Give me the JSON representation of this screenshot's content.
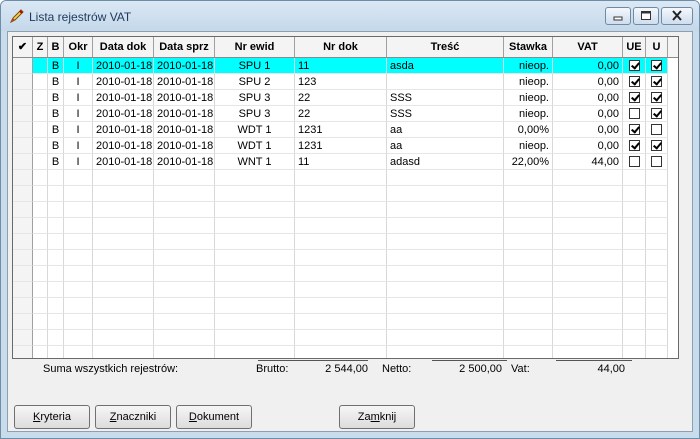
{
  "window": {
    "title": "Lista rejestrów VAT"
  },
  "grid": {
    "columns": [
      {
        "key": "mark",
        "label": "✔"
      },
      {
        "key": "z",
        "label": "Z"
      },
      {
        "key": "b",
        "label": "B"
      },
      {
        "key": "okr",
        "label": "Okr"
      },
      {
        "key": "data_dok",
        "label": "Data dok"
      },
      {
        "key": "data_sprz",
        "label": "Data sprz"
      },
      {
        "key": "nr_ewid",
        "label": "Nr ewid"
      },
      {
        "key": "nr_dok",
        "label": "Nr dok"
      },
      {
        "key": "tresc",
        "label": "Treść"
      },
      {
        "key": "stawka",
        "label": "Stawka"
      },
      {
        "key": "vat",
        "label": "VAT"
      },
      {
        "key": "ue",
        "label": "UE"
      },
      {
        "key": "u",
        "label": "U"
      }
    ],
    "rows": [
      {
        "z": "",
        "b": "B",
        "okr": "I",
        "data_dok": "2010-01-18",
        "data_sprz": "2010-01-18",
        "nr_ewid": "SPU 1",
        "nr_dok": "11",
        "tresc": "asda",
        "stawka": "nieop.",
        "vat": "0,00",
        "ue": true,
        "u": true,
        "selected": true
      },
      {
        "z": "",
        "b": "B",
        "okr": "I",
        "data_dok": "2010-01-18",
        "data_sprz": "2010-01-18",
        "nr_ewid": "SPU 2",
        "nr_dok": "123",
        "tresc": "",
        "stawka": "nieop.",
        "vat": "0,00",
        "ue": true,
        "u": true,
        "selected": false
      },
      {
        "z": "",
        "b": "B",
        "okr": "I",
        "data_dok": "2010-01-18",
        "data_sprz": "2010-01-18",
        "nr_ewid": "SPU 3",
        "nr_dok": "22",
        "tresc": "SSS",
        "stawka": "nieop.",
        "vat": "0,00",
        "ue": true,
        "u": true,
        "selected": false
      },
      {
        "z": "",
        "b": "B",
        "okr": "I",
        "data_dok": "2010-01-18",
        "data_sprz": "2010-01-18",
        "nr_ewid": "SPU 3",
        "nr_dok": "22",
        "tresc": "SSS",
        "stawka": "nieop.",
        "vat": "0,00",
        "ue": false,
        "u": true,
        "selected": false
      },
      {
        "z": "",
        "b": "B",
        "okr": "I",
        "data_dok": "2010-01-18",
        "data_sprz": "2010-01-18",
        "nr_ewid": "WDT 1",
        "nr_dok": "1231",
        "tresc": "aa",
        "stawka": "0,00%",
        "vat": "0,00",
        "ue": true,
        "u": false,
        "selected": false
      },
      {
        "z": "",
        "b": "B",
        "okr": "I",
        "data_dok": "2010-01-18",
        "data_sprz": "2010-01-18",
        "nr_ewid": "WDT 1",
        "nr_dok": "1231",
        "tresc": "aa",
        "stawka": "nieop.",
        "vat": "0,00",
        "ue": true,
        "u": true,
        "selected": false
      },
      {
        "z": "",
        "b": "B",
        "okr": "I",
        "data_dok": "2010-01-18",
        "data_sprz": "2010-01-18",
        "nr_ewid": "WNT 1",
        "nr_dok": "11",
        "tresc": "adasd",
        "stawka": "22,00%",
        "vat": "44,00",
        "ue": false,
        "u": false,
        "selected": false
      }
    ],
    "empty_rows": 12
  },
  "summary": {
    "label": "Suma wszystkich rejestrów:",
    "brutto_label": "Brutto:",
    "brutto": "2 544,00",
    "netto_label": "Netto:",
    "netto": "2 500,00",
    "vat_label": "Vat:",
    "vat": "44,00"
  },
  "buttons": {
    "kryteria": {
      "pre": "",
      "acc": "K",
      "post": "ryteria"
    },
    "znaczniki": {
      "pre": "",
      "acc": "Z",
      "post": "naczniki"
    },
    "dokument": {
      "pre": "",
      "acc": "D",
      "post": "okument"
    },
    "zamknij": {
      "pre": "Za",
      "acc": "m",
      "post": "knij"
    }
  },
  "icons": {
    "app": "pen-icon",
    "minimize": "minimize-icon",
    "maximize": "maximize-icon",
    "close": "close-icon"
  },
  "colors": {
    "selected_row": "#00ffff",
    "titlebar": "#c9dceb"
  }
}
